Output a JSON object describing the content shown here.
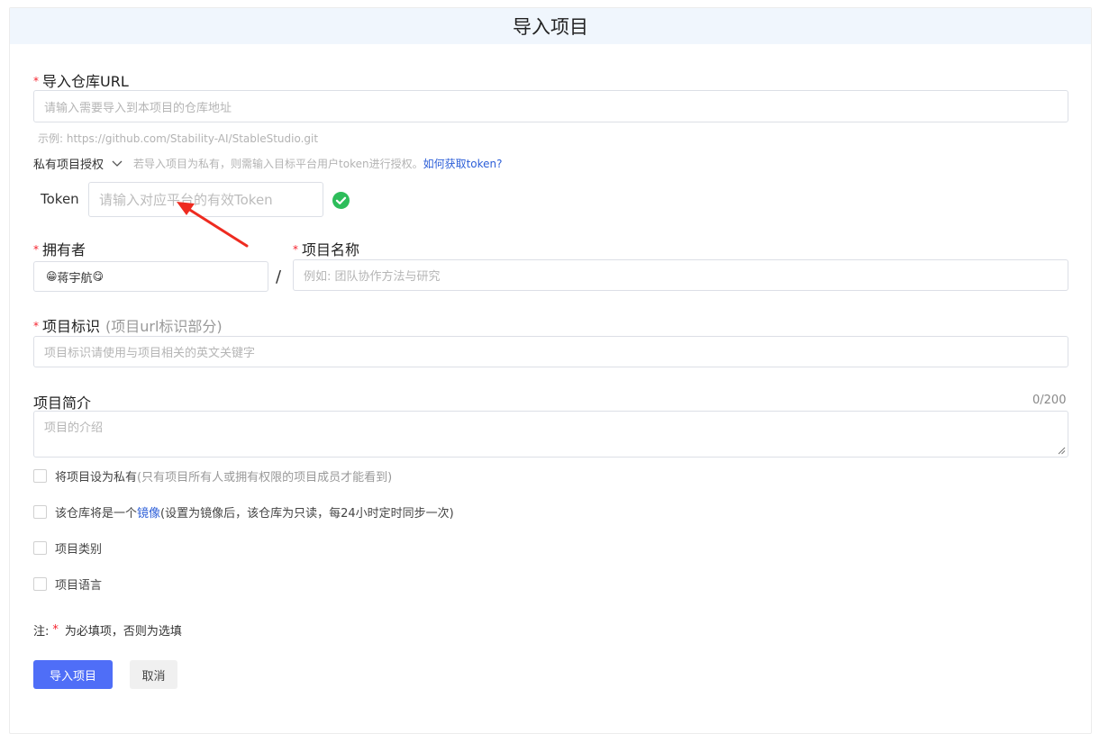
{
  "page": {
    "title": "导入项目"
  },
  "repo_url": {
    "label": "导入仓库URL",
    "placeholder": "请输入需要导入到本项目的仓库地址",
    "example": "示例: https://github.com/Stability-AI/StableStudio.git"
  },
  "private_auth": {
    "label": "私有项目授权",
    "hint": "若导入项目为私有，则需输入目标平台用户token进行授权。",
    "link": "如何获取token?",
    "token_label": "Token",
    "token_placeholder": "请输入对应平台的有效Token",
    "status_icon": "check-circle-icon"
  },
  "owner": {
    "label": "拥有者",
    "value": "蒋宇航",
    "emoji_left": "😁",
    "emoji_right": "😋"
  },
  "separator": "/",
  "project_name": {
    "label": "项目名称",
    "placeholder": "例如: 团队协作方法与研究"
  },
  "project_id": {
    "label": "项目标识",
    "sub": "(项目url标识部分)",
    "placeholder": "项目标识请使用与项目相关的英文关键字"
  },
  "description": {
    "label": "项目简介",
    "count": "0/200",
    "placeholder": "项目的介绍"
  },
  "options": [
    {
      "text": "将项目设为私有",
      "note": "(只有项目所有人或拥有权限的项目成员才能看到)",
      "checked": false
    },
    {
      "text": "该仓库将是一个",
      "link": "镜像",
      "note": "(设置为镜像后，该仓库为只读，每24小时定时同步一次)",
      "checked": false
    },
    {
      "text": "项目类别",
      "checked": false
    },
    {
      "text": "项目语言",
      "checked": false
    }
  ],
  "note": {
    "prefix": "注:",
    "star": "*",
    "text": "为必填项，否则为选填"
  },
  "buttons": {
    "submit": "导入项目",
    "cancel": "取消"
  },
  "colors": {
    "primary": "#4f6ef7",
    "header_bg": "#f0f6fd",
    "required": "#f5222d",
    "success": "#2dbd5a",
    "annotation_arrow": "#ee2b20"
  }
}
